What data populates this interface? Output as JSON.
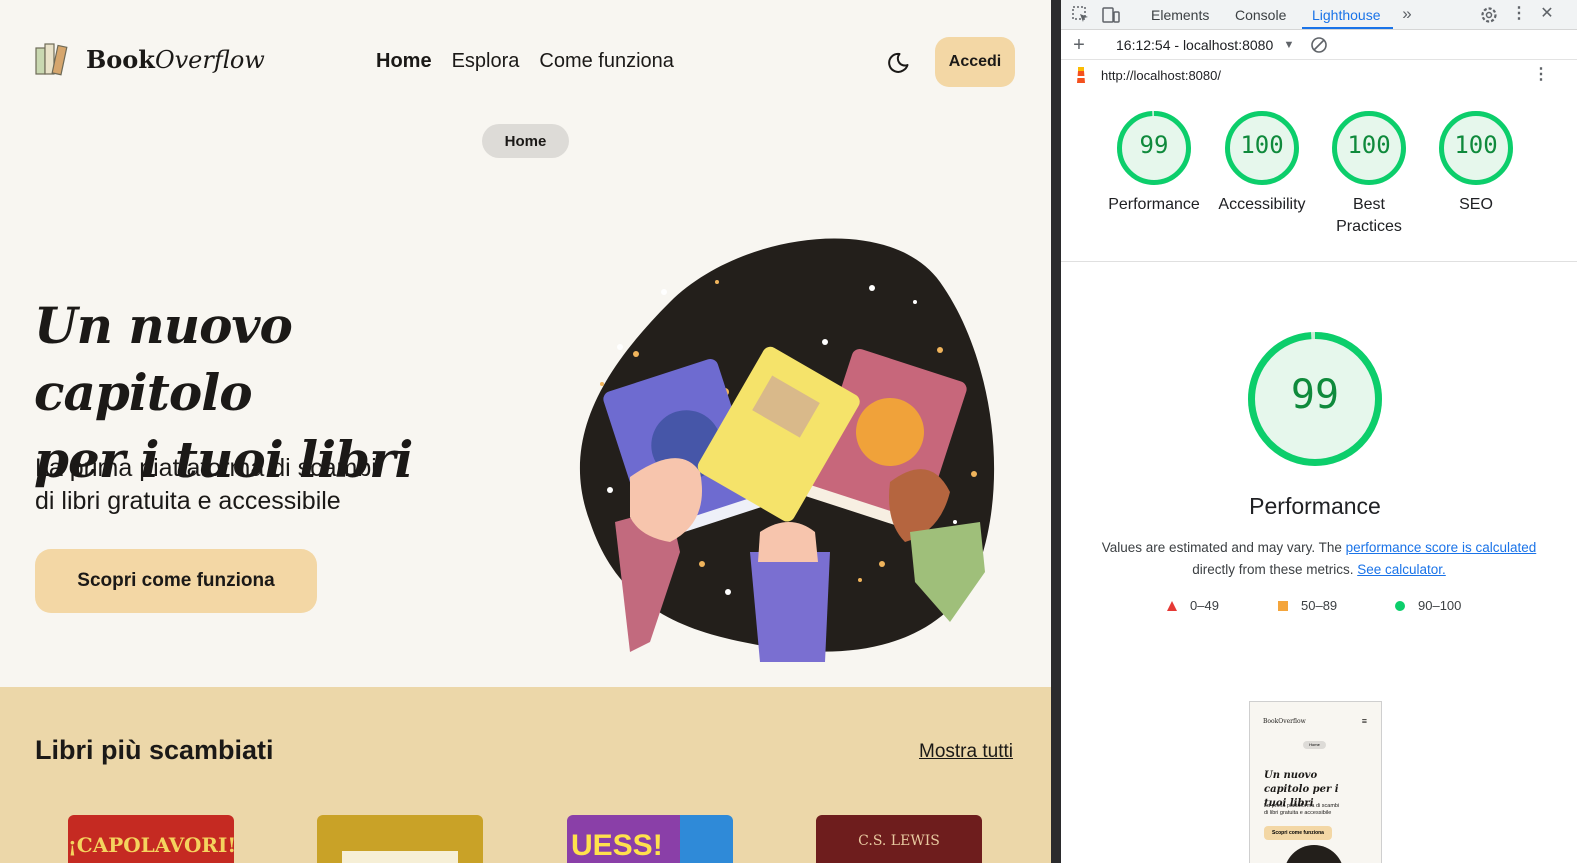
{
  "site": {
    "logo": {
      "name_bold": "Book",
      "name_italic": "Overflow"
    },
    "nav": [
      {
        "label": "Home",
        "active": true
      },
      {
        "label": "Esplora",
        "active": false
      },
      {
        "label": "Come funziona",
        "active": false
      }
    ],
    "login_label": "Accedi",
    "breadcrumb_pill": "Home",
    "hero": {
      "title_line1": "Un nuovo capitolo",
      "title_line2": "per i tuoi libri",
      "subtitle_line1": "La prima piattaforma di scambi",
      "subtitle_line2": "di libri gratuita e accessibile",
      "cta_label": "Scopri come funziona"
    },
    "section": {
      "title": "Libri più scambiati",
      "show_all": "Mostra tutti",
      "covers": [
        {
          "text": "¡CAPOLAVORI!",
          "color": "#c52a22",
          "text_color": "#f4d35e"
        },
        {
          "text": "",
          "color": "#c9a227",
          "text_color": "#ffffff"
        },
        {
          "text": "UESS!",
          "color": "#8a3fa8",
          "text_color": "#ffe14d"
        },
        {
          "text": "C.S. LEWIS",
          "color": "#6e1d1d",
          "text_color": "#e8c9a0"
        }
      ]
    },
    "colors": {
      "background": "#f8f6f1",
      "accent": "#f3d7a5",
      "section": "#ecd7a9"
    }
  },
  "devtools": {
    "tabs": [
      "Elements",
      "Console",
      "Lighthouse"
    ],
    "active_tab": "Lighthouse",
    "report_time": "16:12:54 - localhost:8080",
    "url": "http://localhost:8080/",
    "scores": [
      {
        "value": "99",
        "label": "Performance"
      },
      {
        "value": "100",
        "label": "Accessibility"
      },
      {
        "value": "100",
        "label": "Best Practices"
      },
      {
        "value": "100",
        "label": "SEO"
      }
    ],
    "main": {
      "score": "99",
      "score_fraction": 0.99,
      "title": "Performance",
      "desc_prefix": "Values are estimated and may vary. The ",
      "desc_link1": "performance score is calculated",
      "desc_middle": "directly from these metrics. ",
      "desc_link2": "See calculator."
    },
    "legend": [
      {
        "shape": "triangle",
        "color": "#e53935",
        "label": "0–49"
      },
      {
        "shape": "square",
        "color": "#f4a53c",
        "label": "50–89"
      },
      {
        "shape": "circle",
        "color": "#0cce6b",
        "label": "90–100"
      }
    ],
    "thumbnail": {
      "logo": "BookOverflow",
      "pill": "Home",
      "title": "Un nuovo capitolo per i tuoi libri",
      "subtitle": "La prima piattaforma di scambi di libri gratuita e accessibile",
      "cta": "Scopri come funziona"
    }
  }
}
